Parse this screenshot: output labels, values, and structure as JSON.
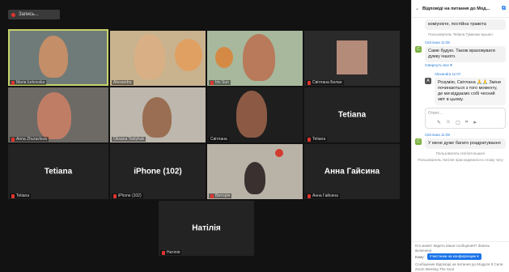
{
  "recording_label": "Запись...",
  "tiles": [
    {
      "name": "Maria Iurkovska"
    },
    {
      "name": "Alexandra"
    },
    {
      "name": "Iris Sun"
    },
    {
      "name": "Світлана Белан"
    },
    {
      "name": "Anna Zhuravlova"
    },
    {
      "name": "Oksana Tselyhuk"
    },
    {
      "name": "Світлана"
    },
    {
      "name": "Tetiana",
      "big": "Tetiana"
    },
    {
      "name": "Tetiana",
      "big": "Tetiana"
    },
    {
      "name": "iPhone (102)",
      "big": "iPhone (102)"
    },
    {
      "name": "Вікторія"
    },
    {
      "name": "Анна Гайсина",
      "big": "Анна Гайсина"
    },
    {
      "name": "Натілія",
      "big": "Натілія"
    }
  ],
  "tile_colors": {
    "active_border": "#c7d36a",
    "muted_mic": "#e0342f"
  },
  "panel": {
    "title": "Відповіді на питання до Мод...",
    "top_text": "коміунікте, постійна травота",
    "sys1": "Пользователь Tetiana Гуменюк вышел",
    "m1_author": "Світлана 11:05",
    "m1_text": "Саме будую. Також враховувати думку іншого.",
    "show_all": "Свернуть все ▾",
    "m2_author": "Alexandra 11:07",
    "m2_text": "Розумію, Світлана 🙏🙏 Зміни починаються з того моменту, де ми віддаємо собі чесний звіт в цьому.",
    "reply_placeholder": "Ответ...",
    "m3_author": "Світлана 11:09",
    "m3_text": "У мене дуже багато роздратування",
    "sys2": "Пользователь Натілія вышел",
    "sys3": "Пользователь Натілія присоединился к этому чату",
    "notice": "Кто может видеть ваши сообщения? Запись включена",
    "to_label": "Кому:",
    "to_value": "Участники на конференции ▾",
    "draft": "Сообщение Відповіді на питання до Модуля 8 Сила Zoom Meeting The Soul"
  }
}
